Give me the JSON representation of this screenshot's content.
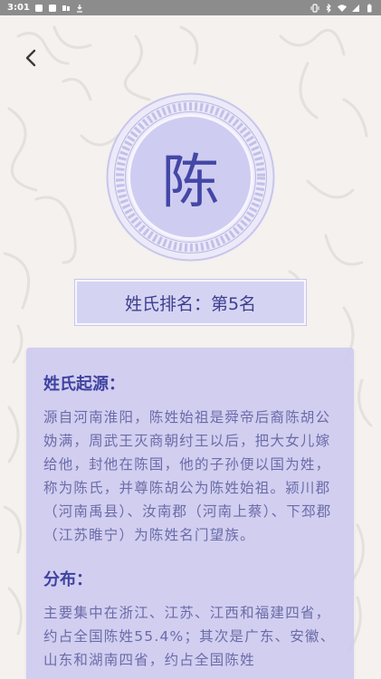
{
  "status_bar": {
    "time": "3:01"
  },
  "surname": {
    "character": "陈"
  },
  "rank": {
    "label": "姓氏排名：第5名"
  },
  "origin": {
    "title": "姓氏起源：",
    "text": "源自河南淮阳，陈姓始祖是舜帝后裔陈胡公妫满，周武王灭商朝纣王以后，把大女儿嫁给他，封他在陈国，他的子孙便以国为姓，称为陈氏，并尊陈胡公为陈姓始祖。颍川郡（河南禹县）、汝南郡（河南上蔡）、下邳郡（江苏睢宁）为陈姓名门望族。"
  },
  "distribution": {
    "title": "分布：",
    "text": "主要集中在浙江、江苏、江西和福建四省，约占全国陈姓55.4%；其次是广东、安徽、山东和湖南四省，约占全国陈姓"
  },
  "colors": {
    "accent": "#4347a6",
    "card": "#cecbf0",
    "rank_bg": "#d5d3f2"
  }
}
